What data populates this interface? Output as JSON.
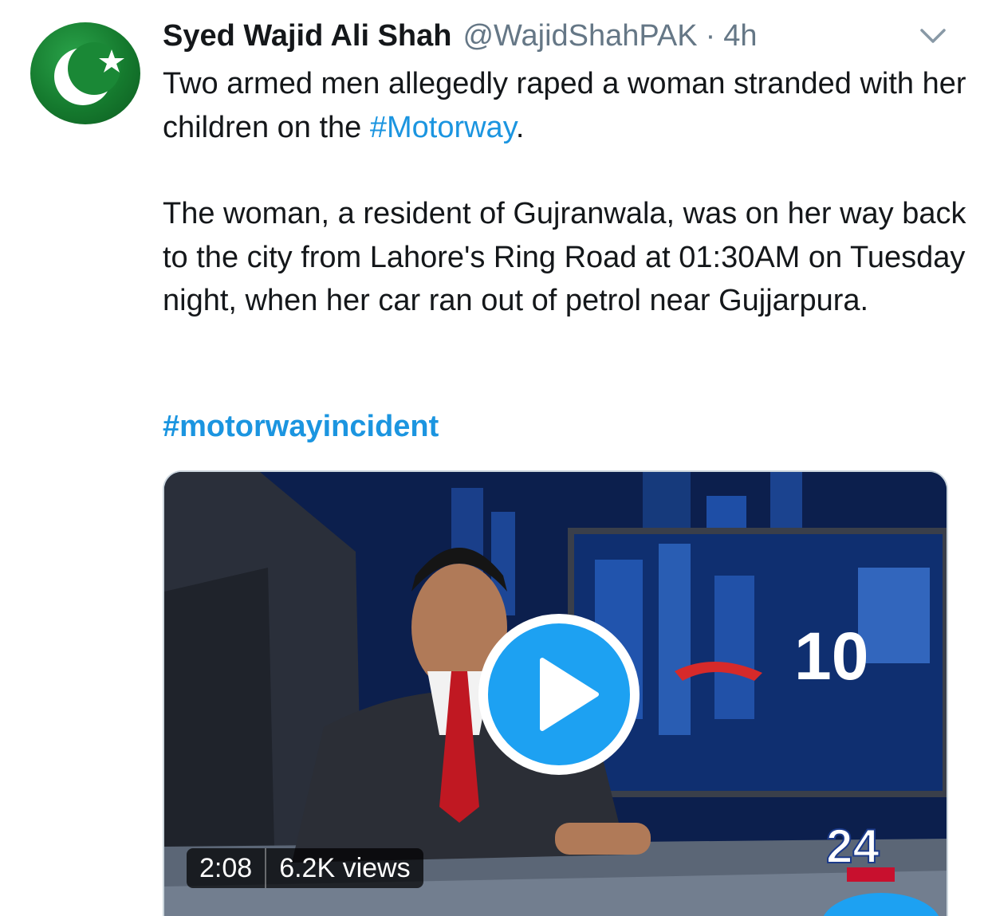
{
  "tweet": {
    "display_name": "Syed Wajid Ali Shah",
    "handle": "@WajidShahPAK",
    "separator": "·",
    "time": "4h",
    "body_line1_prefix": "Two armed men allegedly raped a woman stranded with her children on the ",
    "body_line1_hashtag": "#Motorway",
    "body_line1_suffix": ".",
    "body_para2": "The woman, a resident of Gujranwala, was on her way back to the city from Lahore's Ring Road at 01:30AM on Tuesday night, when her car ran out of petrol near Gujjarpura.",
    "hashtag_bold": "#motorwayincident"
  },
  "media": {
    "duration": "2:08",
    "views": "6.2K views",
    "screen_text": "10",
    "channel_text": "24"
  },
  "icons": {
    "avatar": "pakistan-flag-icon",
    "chevron": "chevron-down-icon",
    "play": "play-icon"
  },
  "colors": {
    "link": "#1b95e0",
    "play_button": "#1da1f2",
    "text_primary": "#14171a",
    "text_secondary": "#657786"
  }
}
